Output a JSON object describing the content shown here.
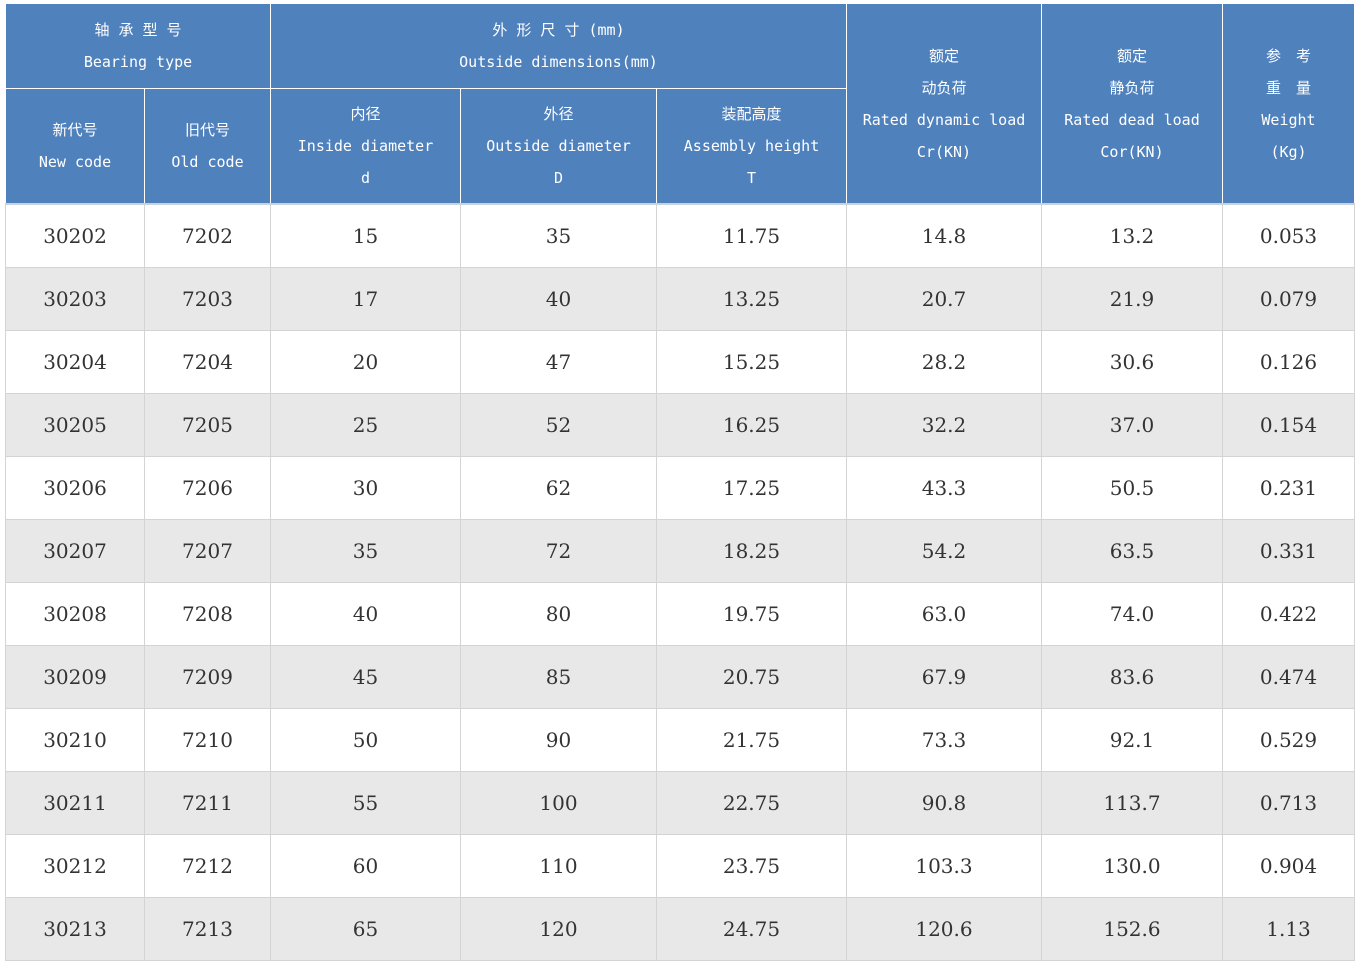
{
  "headers": {
    "bearing_type": {
      "cn": "轴 承 型 号",
      "en": "Bearing type"
    },
    "outside_dims": {
      "cn": "外 形 尺 寸 (mm)",
      "en": "Outside dimensions(mm)"
    },
    "dynamic_load": {
      "cn": "额定",
      "cn2": "动负荷",
      "en": "Rated dynamic load",
      "unit": "Cr(KN)"
    },
    "dead_load": {
      "cn": "额定",
      "cn2": "静负荷",
      "en": "Rated dead load",
      "unit": "Cor(KN)"
    },
    "weight": {
      "cn": "参　考",
      "cn2": "重　量",
      "en": "Weight",
      "unit": "(Kg)"
    },
    "new_code": {
      "cn": "新代号",
      "en": "New code"
    },
    "old_code": {
      "cn": "旧代号",
      "en": "Old code"
    },
    "inside_diameter": {
      "cn": "内径",
      "en": "Inside diameter",
      "sym": "d"
    },
    "outside_diameter": {
      "cn": "外径",
      "en": "Outside diameter",
      "sym": "D"
    },
    "assembly_height": {
      "cn": "装配高度",
      "en": "Assembly height",
      "sym": "T"
    }
  },
  "rows": [
    {
      "new": "30202",
      "old": "7202",
      "d": "15",
      "D": "35",
      "T": "11.75",
      "cr": "14.8",
      "cor": "13.2",
      "w": "0.053"
    },
    {
      "new": "30203",
      "old": "7203",
      "d": "17",
      "D": "40",
      "T": "13.25",
      "cr": "20.7",
      "cor": "21.9",
      "w": "0.079"
    },
    {
      "new": "30204",
      "old": "7204",
      "d": "20",
      "D": "47",
      "T": "15.25",
      "cr": "28.2",
      "cor": "30.6",
      "w": "0.126"
    },
    {
      "new": "30205",
      "old": "7205",
      "d": "25",
      "D": "52",
      "T": "16.25",
      "cr": "32.2",
      "cor": "37.0",
      "w": "0.154"
    },
    {
      "new": "30206",
      "old": "7206",
      "d": "30",
      "D": "62",
      "T": "17.25",
      "cr": "43.3",
      "cor": "50.5",
      "w": "0.231"
    },
    {
      "new": "30207",
      "old": "7207",
      "d": "35",
      "D": "72",
      "T": "18.25",
      "cr": "54.2",
      "cor": "63.5",
      "w": "0.331"
    },
    {
      "new": "30208",
      "old": "7208",
      "d": "40",
      "D": "80",
      "T": "19.75",
      "cr": "63.0",
      "cor": "74.0",
      "w": "0.422"
    },
    {
      "new": "30209",
      "old": "7209",
      "d": "45",
      "D": "85",
      "T": "20.75",
      "cr": "67.9",
      "cor": "83.6",
      "w": "0.474"
    },
    {
      "new": "30210",
      "old": "7210",
      "d": "50",
      "D": "90",
      "T": "21.75",
      "cr": "73.3",
      "cor": "92.1",
      "w": "0.529"
    },
    {
      "new": "30211",
      "old": "7211",
      "d": "55",
      "D": "100",
      "T": "22.75",
      "cr": "90.8",
      "cor": "113.7",
      "w": "0.713"
    },
    {
      "new": "30212",
      "old": "7212",
      "d": "60",
      "D": "110",
      "T": "23.75",
      "cr": "103.3",
      "cor": "130.0",
      "w": "0.904"
    },
    {
      "new": "30213",
      "old": "7213",
      "d": "65",
      "D": "120",
      "T": "24.75",
      "cr": "120.6",
      "cor": "152.6",
      "w": "1.13"
    }
  ]
}
